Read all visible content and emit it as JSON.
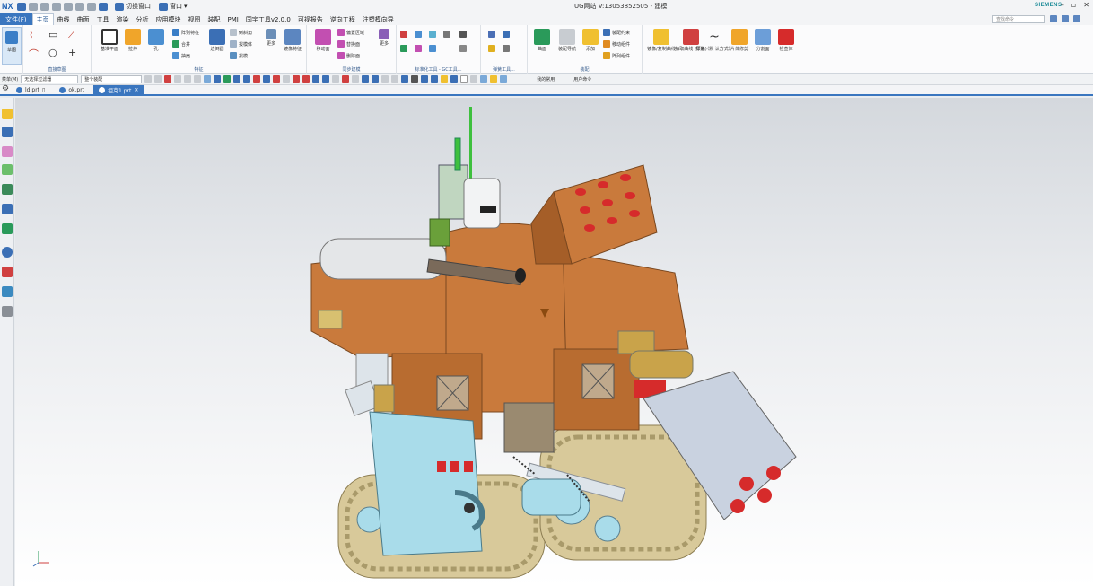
{
  "titlebar": {
    "logo": "NX",
    "switch_window_label": "切换窗口",
    "window_menu_label": "窗口",
    "title": "UG网站  V:13053852505 - 建模",
    "brand": "SIEMENS",
    "minimize": "–",
    "restore": "▫",
    "close": "✕"
  },
  "menu": {
    "file": "文件(F)",
    "tabs": [
      "主页",
      "曲线",
      "曲面",
      "工具",
      "渲染",
      "分析",
      "应用模块",
      "视图",
      "装配",
      "PMI",
      "国宇工具v2.0.0",
      "可视报告",
      "逆向工程",
      "注塑模向导"
    ],
    "active_tab": 0,
    "search_placeholder": "查找命令"
  },
  "ribbon": {
    "sketch": "草图",
    "direct_sketch_group": "直接草图",
    "feature_group": "特征",
    "sync_group": "同步建模",
    "standard_group": "标准化工具 - GC工具...",
    "gear_group": "齿轮建...",
    "spring_group": "弹簧工具...",
    "assembly_group": "装配",
    "feature_buttons": {
      "datum_plane": "基准平面",
      "extrude": "拉伸",
      "hole": "孔",
      "pattern_feature": "阵列特征",
      "unite": "合并",
      "shell": "抽壳",
      "edge_blend": "边倒圆",
      "chamfer": "倒斜角",
      "draft": "拔模体",
      "more": "更多",
      "mirror_feature": "镜像特征"
    },
    "sync_buttons": {
      "move_face": "移动面",
      "offset_region": "偏置区域",
      "replace_face": "替换面",
      "delete_face": "删除面",
      "more": "更多"
    },
    "assembly_buttons": {
      "surface": "曲面",
      "component_pattern": "装配导航",
      "add": "添加",
      "assembly_constraint": "装配约束",
      "move_component": "移动组件",
      "pattern_component": "阵列组件"
    },
    "right_buttons": {
      "mirror_curve": "镜像/复制曲线",
      "extract_curve": "抽取曲线\n(原始)",
      "spline": "样条（默\n认方式）",
      "surface_trim": "片体修剪",
      "section": "分割面",
      "check_body": "检查体"
    }
  },
  "selection_bar": {
    "menu": "菜单(M)",
    "filter": "无选择过滤器",
    "scope": "整个装配",
    "right1": "我的常用",
    "right2": "用户命令"
  },
  "doc_tabs": [
    {
      "name": "ld.prt",
      "active": false
    },
    {
      "name": "ok.prt",
      "active": false
    },
    {
      "name": "坦克1.prt",
      "active": true
    }
  ],
  "colors": {
    "accent": "#3a76bf",
    "tank_body": "#c97a3c",
    "track": "#d8c99a",
    "cyan_part": "#a9dcea",
    "red_accent": "#d62b2b"
  }
}
